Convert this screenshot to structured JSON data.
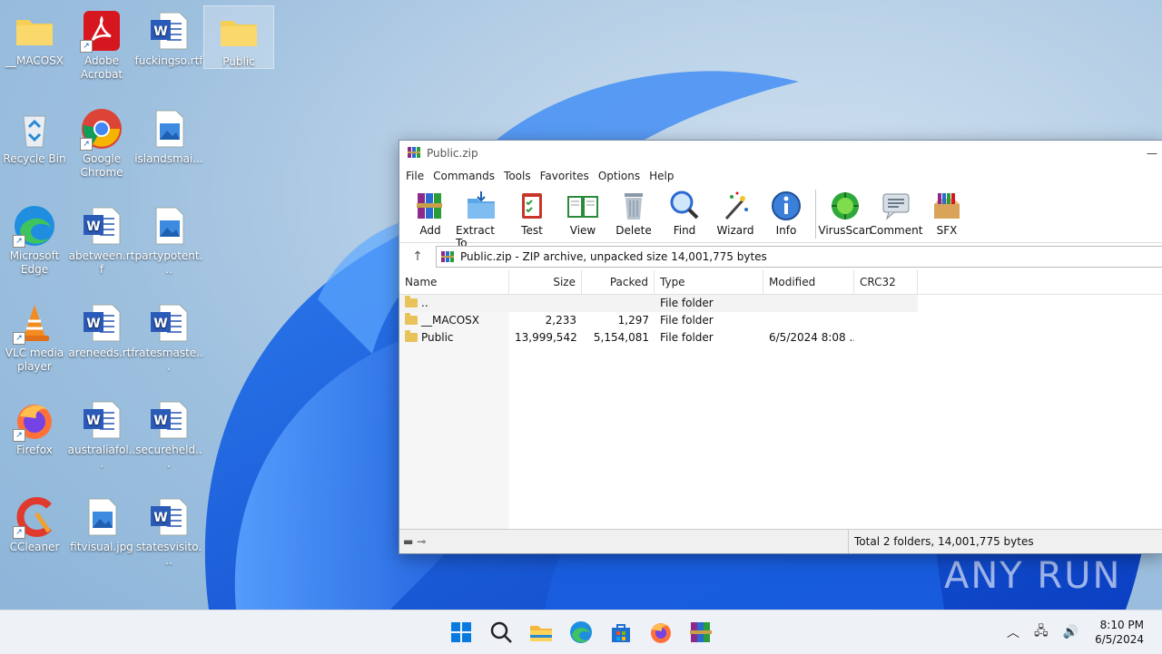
{
  "desktop": {
    "icons": [
      {
        "label": "__MACOSX"
      },
      {
        "label": "Adobe Acrobat"
      },
      {
        "label": "fuckingso.rtf"
      },
      {
        "label": "Public"
      },
      {
        "label": "Recycle Bin"
      },
      {
        "label": "Google Chrome"
      },
      {
        "label": "islandsmai..."
      },
      {
        "label": "Microsoft Edge"
      },
      {
        "label": "abetween.rtf"
      },
      {
        "label": "partypotent..."
      },
      {
        "label": "VLC media player"
      },
      {
        "label": "areneeds.rtf"
      },
      {
        "label": "ratesmaste..."
      },
      {
        "label": "Firefox"
      },
      {
        "label": "australiafol..."
      },
      {
        "label": "secureheld..."
      },
      {
        "label": "CCleaner"
      },
      {
        "label": "fitvisual.jpg"
      },
      {
        "label": "statesvisito..."
      }
    ],
    "watermark": "ANY RUN"
  },
  "window": {
    "title": "Public.zip",
    "menu": [
      "File",
      "Commands",
      "Tools",
      "Favorites",
      "Options",
      "Help"
    ],
    "toolbar": [
      "Add",
      "Extract To",
      "Test",
      "View",
      "Delete",
      "Find",
      "Wizard",
      "Info",
      "VirusScan",
      "Comment",
      "SFX"
    ],
    "address": "Public.zip - ZIP archive, unpacked size 14,001,775 bytes",
    "columns": [
      "Name",
      "Size",
      "Packed",
      "Type",
      "Modified",
      "CRC32"
    ],
    "rows": [
      {
        "name": "..",
        "size": "",
        "packed": "",
        "type": "File folder",
        "modified": "",
        "crc": ""
      },
      {
        "name": "__MACOSX",
        "size": "2,233",
        "packed": "1,297",
        "type": "File folder",
        "modified": "",
        "crc": ""
      },
      {
        "name": "Public",
        "size": "13,999,542",
        "packed": "5,154,081",
        "type": "File folder",
        "modified": "6/5/2024 8:08 ...",
        "crc": ""
      }
    ],
    "status_total": "Total 2 folders, 14,001,775 bytes"
  },
  "taskbar": {
    "time": "8:10 PM",
    "date": "6/5/2024"
  }
}
